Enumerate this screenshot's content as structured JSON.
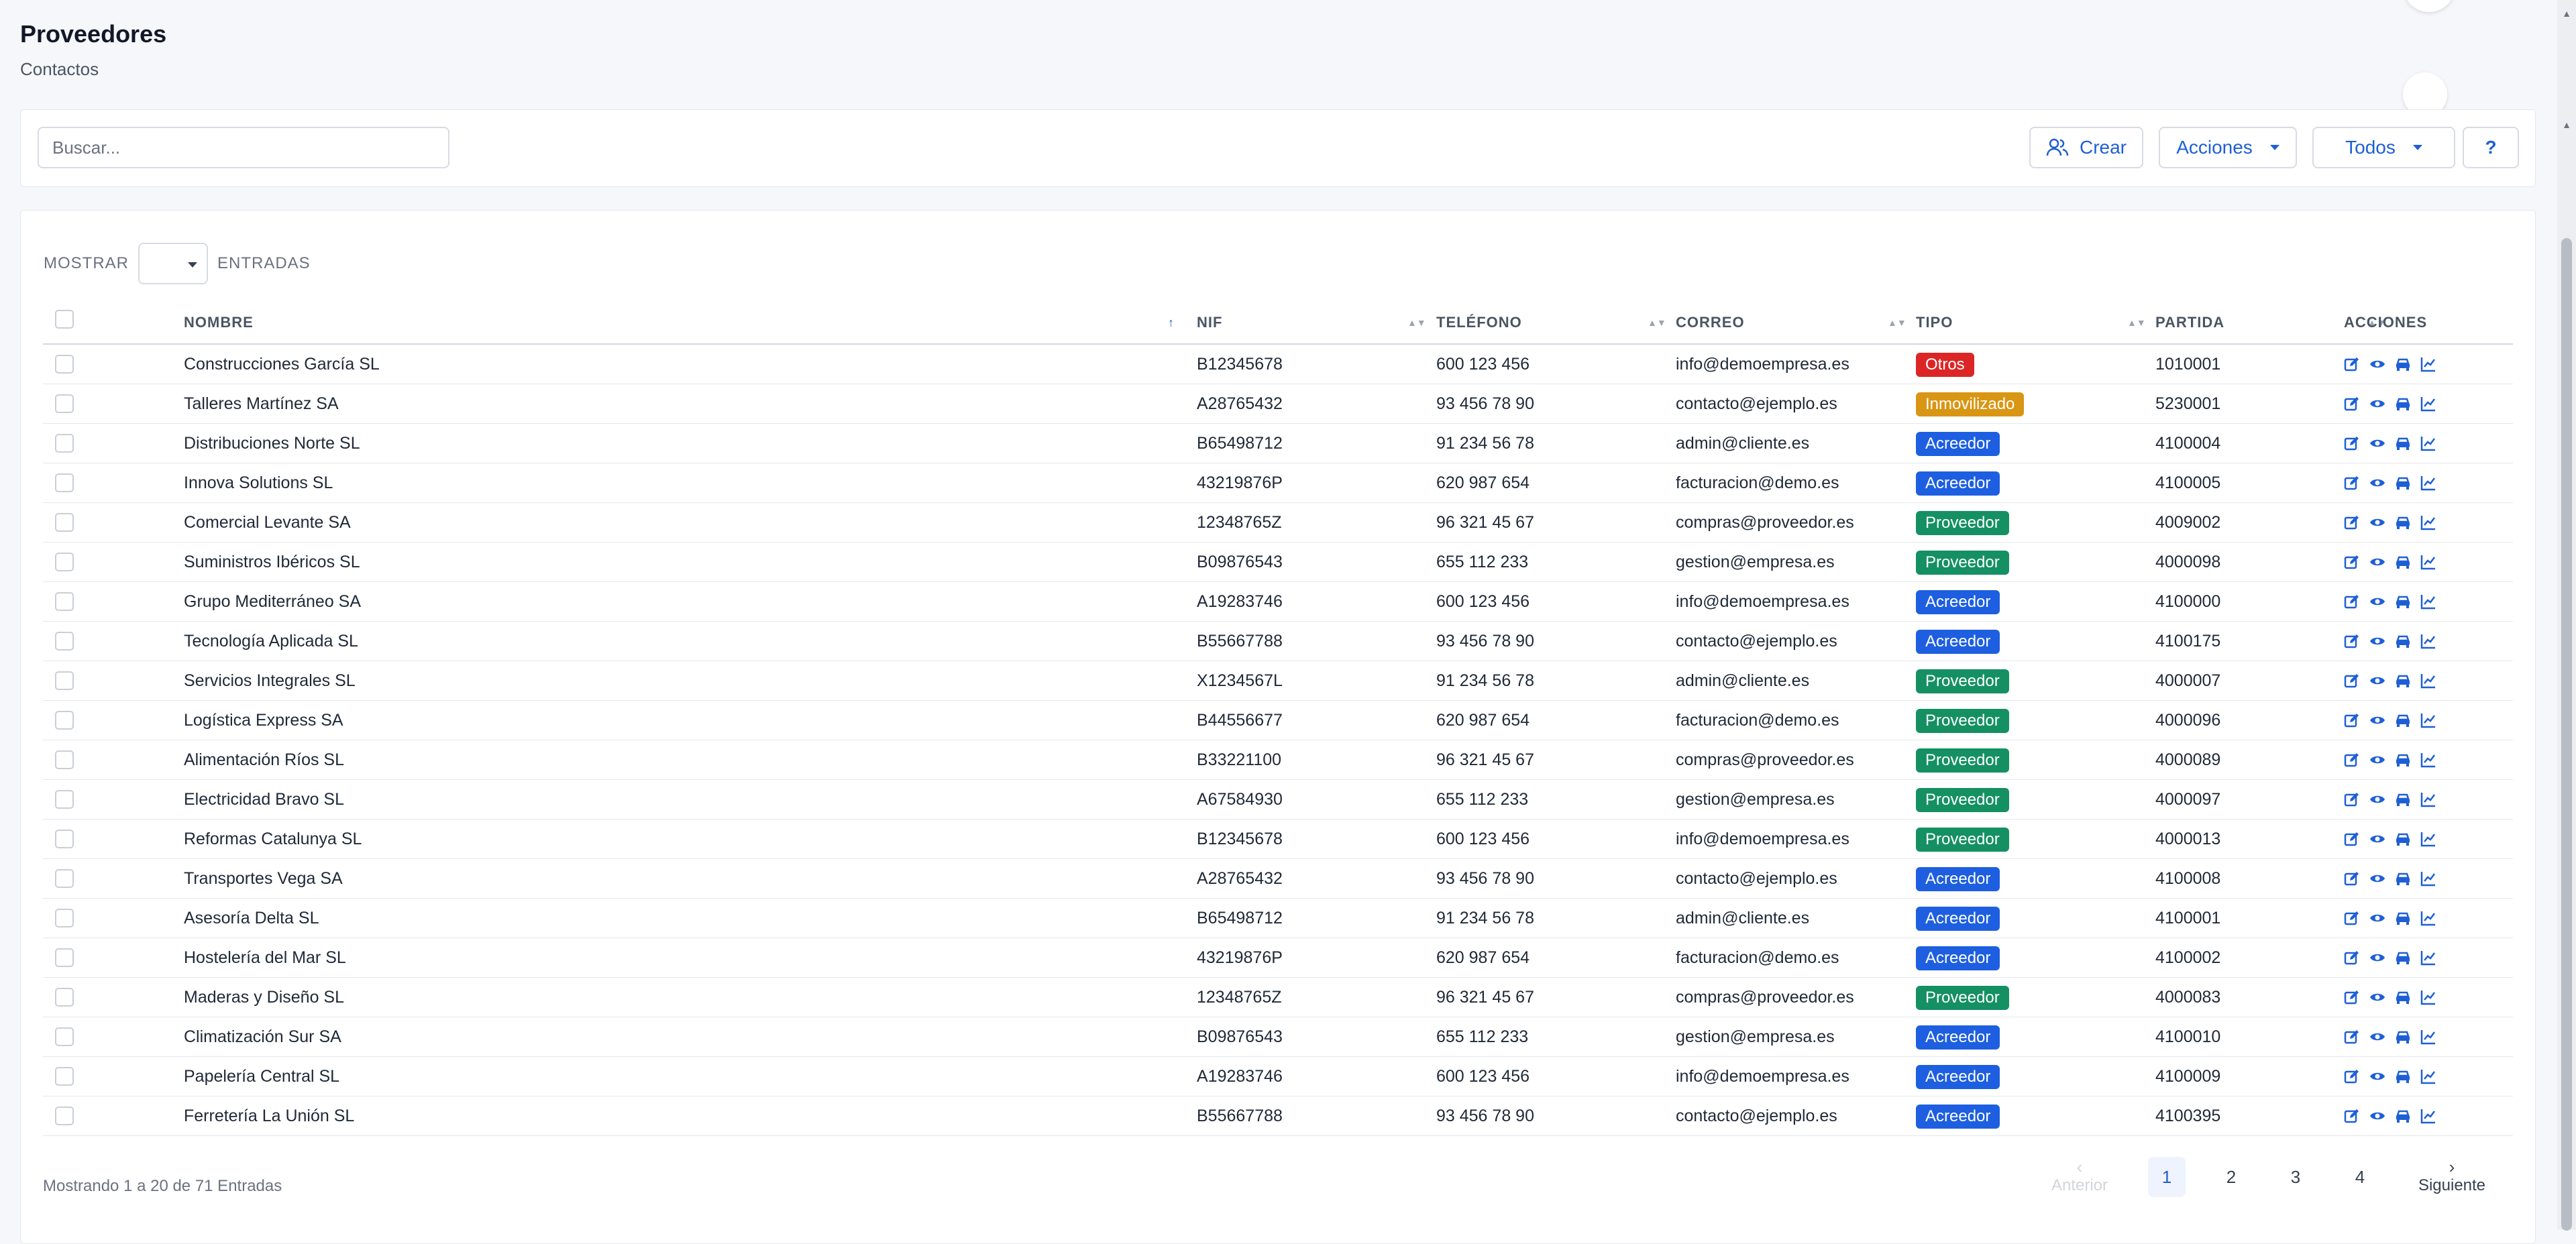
{
  "header": {
    "title": "Proveedores",
    "subtitle": "Contactos"
  },
  "toolbar": {
    "search_placeholder": "Buscar...",
    "create_label": "Crear",
    "actions_label": "Acciones",
    "filter_label": "Todos",
    "help_label": "?"
  },
  "entries": {
    "show_label": "MOSTRAR",
    "entries_label": "ENTRADAS"
  },
  "table": {
    "columns": [
      "NOMBRE",
      "NIF",
      "TELÉFONO",
      "CORREO",
      "TIPO",
      "PARTIDA",
      "ACCIONES"
    ],
    "rows": [
      {
        "nombre": "Construcciones García SL",
        "nif": "B12345678",
        "telefono": "600 123 456",
        "correo": "info@demoempresa.es",
        "tipo": "Otros",
        "partida": "1010001"
      },
      {
        "nombre": "Talleres Martínez SA",
        "nif": "A28765432",
        "telefono": "93 456 78 90",
        "correo": "contacto@ejemplo.es",
        "tipo": "Inmovilizado",
        "partida": "5230001"
      },
      {
        "nombre": "Distribuciones Norte SL",
        "nif": "B65498712",
        "telefono": "91 234 56 78",
        "correo": "admin@cliente.es",
        "tipo": "Acreedor",
        "partida": "4100004"
      },
      {
        "nombre": "Innova Solutions SL",
        "nif": "43219876P",
        "telefono": "620 987 654",
        "correo": "facturacion@demo.es",
        "tipo": "Acreedor",
        "partida": "4100005"
      },
      {
        "nombre": "Comercial Levante SA",
        "nif": "12348765Z",
        "telefono": "96 321 45 67",
        "correo": "compras@proveedor.es",
        "tipo": "Proveedor",
        "partida": "4009002"
      },
      {
        "nombre": "Suministros Ibéricos SL",
        "nif": "B09876543",
        "telefono": "655 112 233",
        "correo": "gestion@empresa.es",
        "tipo": "Proveedor",
        "partida": "4000098"
      },
      {
        "nombre": "Grupo Mediterráneo SA",
        "nif": "A19283746",
        "telefono": "600 123 456",
        "correo": "info@demoempresa.es",
        "tipo": "Acreedor",
        "partida": "4100000"
      },
      {
        "nombre": "Tecnología Aplicada SL",
        "nif": "B55667788",
        "telefono": "93 456 78 90",
        "correo": "contacto@ejemplo.es",
        "tipo": "Acreedor",
        "partida": "4100175"
      },
      {
        "nombre": "Servicios Integrales SL",
        "nif": "X1234567L",
        "telefono": "91 234 56 78",
        "correo": "admin@cliente.es",
        "tipo": "Proveedor",
        "partida": "4000007"
      },
      {
        "nombre": "Logística Express SA",
        "nif": "B44556677",
        "telefono": "620 987 654",
        "correo": "facturacion@demo.es",
        "tipo": "Proveedor",
        "partida": "4000096"
      },
      {
        "nombre": "Alimentación Ríos SL",
        "nif": "B33221100",
        "telefono": "96 321 45 67",
        "correo": "compras@proveedor.es",
        "tipo": "Proveedor",
        "partida": "4000089"
      },
      {
        "nombre": "Electricidad Bravo SL",
        "nif": "A67584930",
        "telefono": "655 112 233",
        "correo": "gestion@empresa.es",
        "tipo": "Proveedor",
        "partida": "4000097"
      },
      {
        "nombre": "Reformas Catalunya SL",
        "nif": "B12345678",
        "telefono": "600 123 456",
        "correo": "info@demoempresa.es",
        "tipo": "Proveedor",
        "partida": "4000013"
      },
      {
        "nombre": "Transportes Vega SA",
        "nif": "A28765432",
        "telefono": "93 456 78 90",
        "correo": "contacto@ejemplo.es",
        "tipo": "Acreedor",
        "partida": "4100008"
      },
      {
        "nombre": "Asesoría Delta SL",
        "nif": "B65498712",
        "telefono": "91 234 56 78",
        "correo": "admin@cliente.es",
        "tipo": "Acreedor",
        "partida": "4100001"
      },
      {
        "nombre": "Hostelería del Mar SL",
        "nif": "43219876P",
        "telefono": "620 987 654",
        "correo": "facturacion@demo.es",
        "tipo": "Acreedor",
        "partida": "4100002"
      },
      {
        "nombre": "Maderas y Diseño SL",
        "nif": "12348765Z",
        "telefono": "96 321 45 67",
        "correo": "compras@proveedor.es",
        "tipo": "Proveedor",
        "partida": "4000083"
      },
      {
        "nombre": "Climatización Sur SA",
        "nif": "B09876543",
        "telefono": "655 112 233",
        "correo": "gestion@empresa.es",
        "tipo": "Acreedor",
        "partida": "4100010"
      },
      {
        "nombre": "Papelería Central SL",
        "nif": "A19283746",
        "telefono": "600 123 456",
        "correo": "info@demoempresa.es",
        "tipo": "Acreedor",
        "partida": "4100009"
      },
      {
        "nombre": "Ferretería La Unión SL",
        "nif": "B55667788",
        "telefono": "93 456 78 90",
        "correo": "contacto@ejemplo.es",
        "tipo": "Acreedor",
        "partida": "4100395"
      }
    ],
    "row_action_icons": [
      "edit-icon",
      "eye-icon",
      "car-icon",
      "chart-line-icon"
    ]
  },
  "badge_colors": {
    "Otros": "#dc2626",
    "Inmovilizado": "#d99614",
    "Acreedor": "#1d5fe0",
    "Proveedor": "#159063"
  },
  "footer": {
    "info": "Mostrando 1 a 20 de 71 Entradas",
    "prev_label": "Anterior",
    "next_label": "Siguiente",
    "pages": [
      "1",
      "2",
      "3",
      "4"
    ],
    "current_page": "1"
  },
  "colors": {
    "accent": "#1e5fd6",
    "background": "#f6f7fb"
  }
}
